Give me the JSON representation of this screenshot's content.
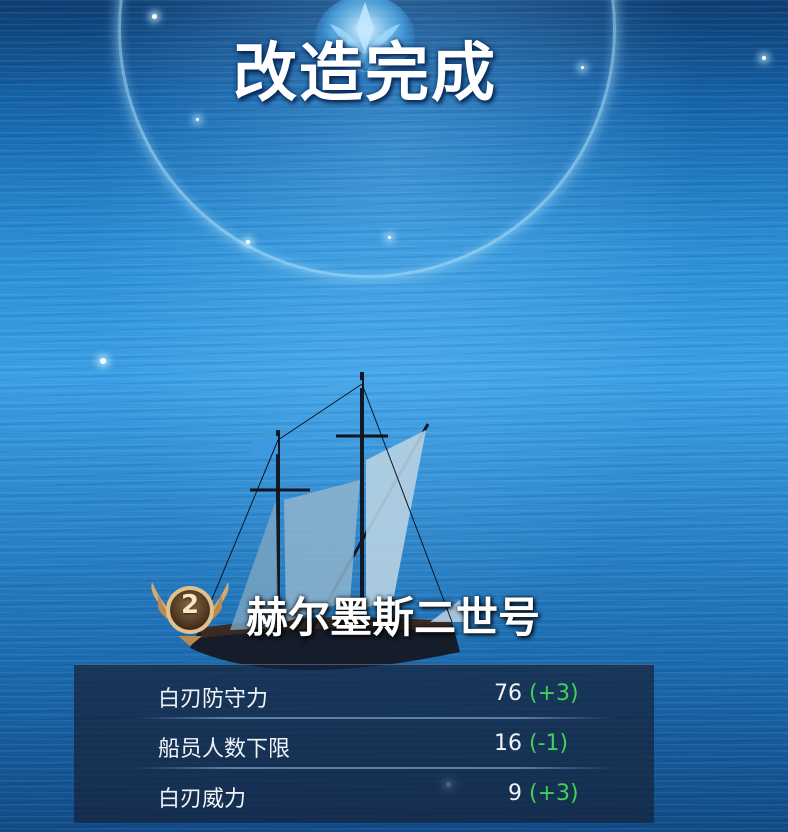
{
  "screen": {
    "title": "改造完成"
  },
  "ship": {
    "level": "2",
    "name": "赫尔墨斯二世号"
  },
  "stats": [
    {
      "label": "白刃防守力",
      "value": "76",
      "delta": "(+3)"
    },
    {
      "label": "船员人数下限",
      "value": "16",
      "delta": "(-1)"
    },
    {
      "label": "白刃威力",
      "value": "9",
      "delta": "(+3)"
    }
  ],
  "colors": {
    "delta_positive": "#3fd25a",
    "badge_gold": "#c9a06a",
    "sea": "#2a8fd6"
  },
  "icons": {
    "top_emblem": "lotus-emblem-icon",
    "level_badge": "winged-rank-badge-icon"
  }
}
